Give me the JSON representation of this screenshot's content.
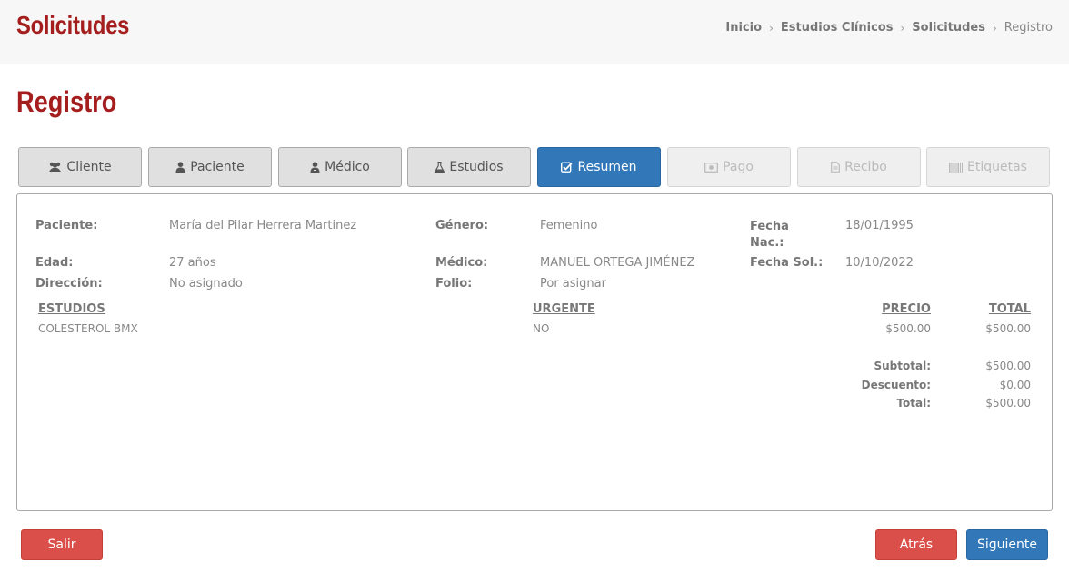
{
  "header": {
    "title": "Solicitudes",
    "breadcrumb": [
      "Inicio",
      "Estudios Clínicos",
      "Solicitudes",
      "Registro"
    ],
    "separator": "›"
  },
  "page": {
    "title": "Registro"
  },
  "tabs": [
    {
      "label": "Cliente",
      "icon": "users-icon",
      "state": "default"
    },
    {
      "label": "Paciente",
      "icon": "user-icon",
      "state": "default"
    },
    {
      "label": "Médico",
      "icon": "user-md-icon",
      "state": "default"
    },
    {
      "label": "Estudios",
      "icon": "flask-icon",
      "state": "default"
    },
    {
      "label": "Resumen",
      "icon": "check-square-icon",
      "state": "active"
    },
    {
      "label": "Pago",
      "icon": "money-icon",
      "state": "disabled"
    },
    {
      "label": "Recibo",
      "icon": "file-text-icon",
      "state": "disabled"
    },
    {
      "label": "Etiquetas",
      "icon": "barcode-icon",
      "state": "disabled"
    }
  ],
  "summary": {
    "paciente": {
      "label": "Paciente:",
      "value": "María del Pilar Herrera Martinez"
    },
    "genero": {
      "label": "Género:",
      "value": "Femenino"
    },
    "fecha_nac": {
      "label_line1": "Fecha",
      "label_line2": "Nac.:",
      "value": "18/01/1995"
    },
    "edad": {
      "label": "Edad:",
      "value": "27 años"
    },
    "medico": {
      "label": "Médico:",
      "value": "MANUEL ORTEGA JIMÉNEZ"
    },
    "fecha_sol": {
      "label": "Fecha Sol.:",
      "value": "10/10/2022"
    },
    "direccion": {
      "label": "Dirección:",
      "value": "No asignado"
    },
    "folio": {
      "label": "Folio:",
      "value": "Por asignar"
    }
  },
  "studies": {
    "headers": {
      "estudios": "ESTUDIOS",
      "urgente": "URGENTE",
      "precio": "PRECIO",
      "total": "TOTAL"
    },
    "rows": [
      {
        "estudio": "COLESTEROL BMX",
        "urgente": "NO",
        "precio": "$500.00",
        "total": "$500.00"
      }
    ]
  },
  "totals": {
    "subtotal": {
      "label": "Subtotal:",
      "value": "$500.00"
    },
    "descuento": {
      "label": "Descuento:",
      "value": "$0.00"
    },
    "total": {
      "label": "Total:",
      "value": "$500.00"
    }
  },
  "buttons": {
    "salir": "Salir",
    "atras": "Atrás",
    "siguiente": "Siguiente"
  },
  "colors": {
    "brand": "#a51e1e",
    "primary": "#3277b8",
    "danger": "#db4f4a"
  }
}
